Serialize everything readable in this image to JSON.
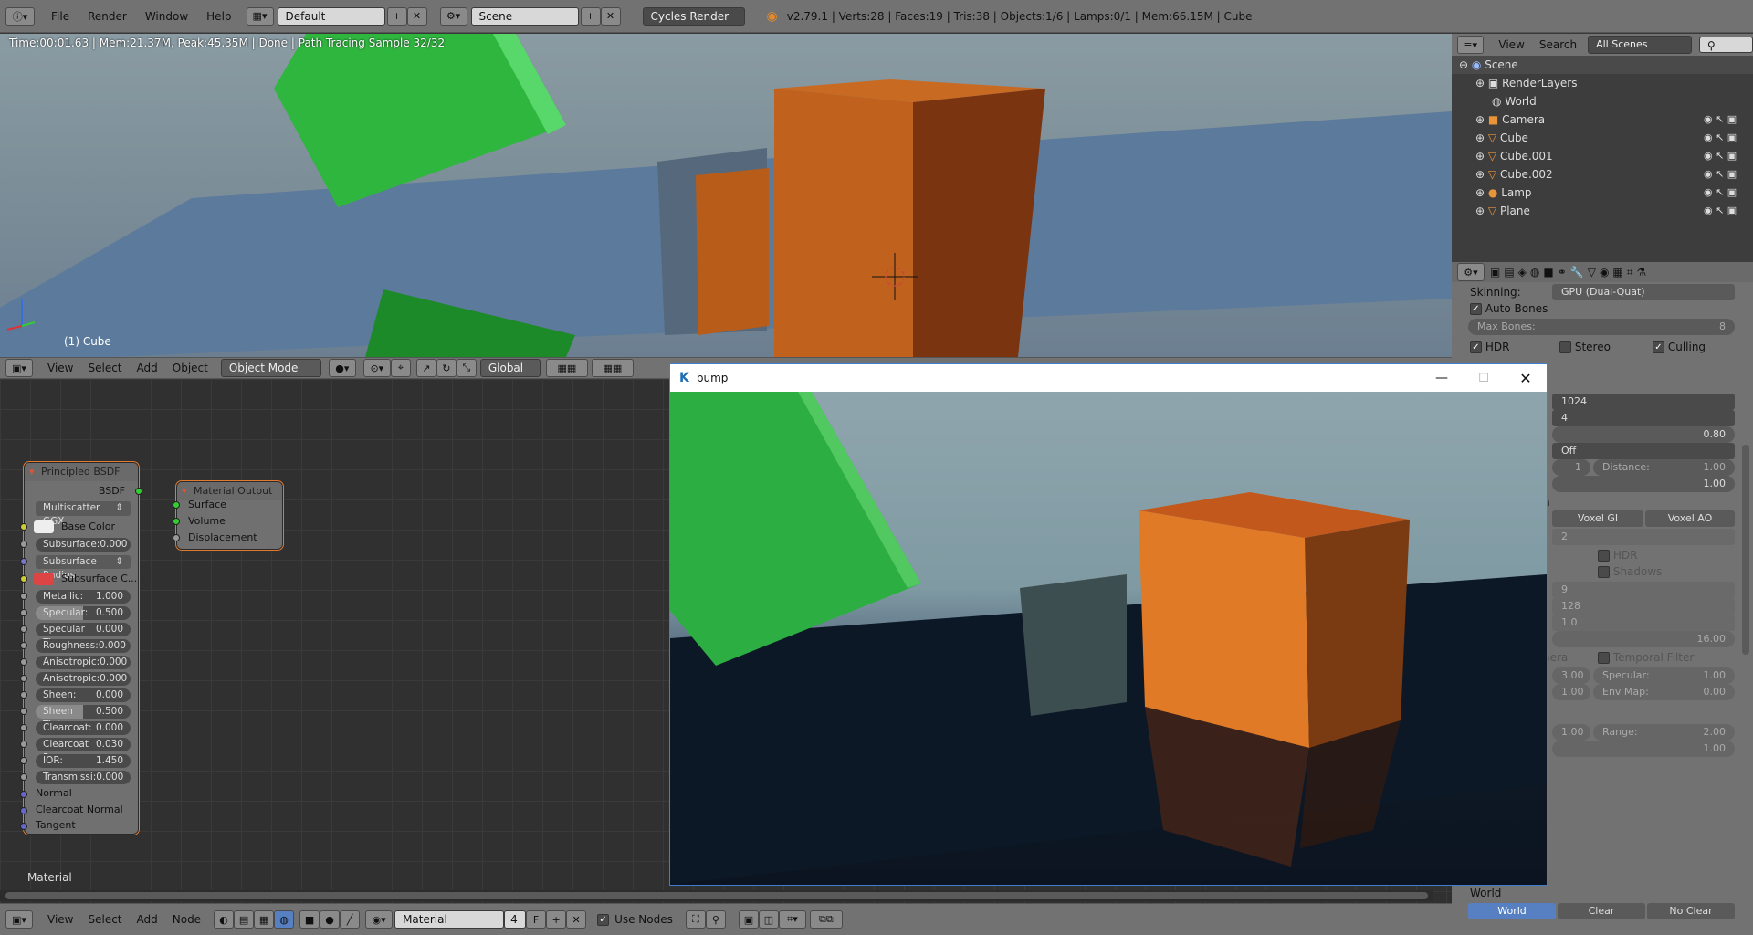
{
  "topbar": {
    "menus": [
      "File",
      "Render",
      "Window",
      "Help"
    ],
    "layout": "Default",
    "scene": "Scene",
    "engine": "Cycles Render",
    "stats": "v2.79.1 | Verts:28 | Faces:19 | Tris:38 | Objects:1/6 | Lamps:0/1 | Mem:66.15M | Cube"
  },
  "viewport": {
    "render_status": "Time:00:01.63 | Mem:21.37M, Peak:45.35M | Done | Path Tracing Sample 32/32",
    "object_label": "(1) Cube",
    "header": {
      "menus": [
        "View",
        "Select",
        "Add",
        "Object"
      ],
      "mode": "Object Mode",
      "orientation": "Global"
    }
  },
  "outliner": {
    "menus": [
      "View",
      "Search"
    ],
    "filter": "All Scenes",
    "items": [
      "Scene",
      "RenderLayers",
      "World",
      "Camera",
      "Cube",
      "Cube.001",
      "Cube.002",
      "Lamp",
      "Plane"
    ]
  },
  "properties": {
    "skinning_label": "Skinning:",
    "skinning_value": "GPU (Dual-Quat)",
    "auto_bones": "Auto Bones",
    "max_bones_label": "Max Bones:",
    "max_bones_value": "8",
    "hdr": "HDR",
    "stereo": "Stereo",
    "culling": "Culling",
    "v1024": "1024",
    "v4": "4",
    "v080": "0.80",
    "off": "Off",
    "v1": "1",
    "distance_label": "Distance:",
    "distance_value": "1.00",
    "v100a": "1.00",
    "h_letter": "h",
    "voxel_gi": "Voxel GI",
    "voxel_ao": "Voxel AO",
    "v2": "2",
    "hdr2": "HDR",
    "shadows": "Shadows",
    "v9": "9",
    "v128": "128",
    "v10": "1.0",
    "v1600": "16.00",
    "nera": "nera",
    "temporal_filter": "Temporal Filter",
    "v300": "3.00",
    "specular_label": "Specular:",
    "specular_value": "1.00",
    "v100b": "1.00",
    "envmap_label": "Env Map:",
    "envmap_value": "0.00",
    "v100c": "1.00",
    "range_label": "Range:",
    "range_value": "2.00",
    "v100d": "1.00",
    "world_section": "World",
    "world_btn": "World",
    "clear_btn": "Clear",
    "noclear_btn": "No Clear"
  },
  "bump_window": {
    "title": "bump"
  },
  "node_editor": {
    "principled": {
      "title": "Principled BSDF",
      "output": "BSDF",
      "distribution": "Multiscatter GGX",
      "base_color": "Base Color",
      "subsurface": "Subsurface:",
      "subsurface_v": "0.000",
      "subsurface_radius": "Subsurface Radius",
      "subsurface_color": "Subsurface C...",
      "metallic": "Metallic:",
      "metallic_v": "1.000",
      "specular": "Specular:",
      "specular_v": "0.500",
      "spec_tint": "Specular Ti:",
      "spec_tint_v": "0.000",
      "roughness": "Roughness:",
      "roughness_v": "0.000",
      "aniso": "Anisotropic:",
      "aniso_v": "0.000",
      "aniso_rot": "Anisotropic:",
      "aniso_rot_v": "0.000",
      "sheen": "Sheen:",
      "sheen_v": "0.000",
      "sheen_tint": "Sheen Tint:",
      "sheen_tint_v": "0.500",
      "clearcoat": "Clearcoat:",
      "clearcoat_v": "0.000",
      "clearcoat_r": "Clearcoat R:",
      "clearcoat_r_v": "0.030",
      "ior": "IOR:",
      "ior_v": "1.450",
      "transmission": "Transmissi:",
      "transmission_v": "0.000",
      "normal": "Normal",
      "clearcoat_normal": "Clearcoat Normal",
      "tangent": "Tangent"
    },
    "output_node": {
      "title": "Material Output",
      "surface": "Surface",
      "volume": "Volume",
      "displacement": "Displacement"
    },
    "footer_label": "Material",
    "header": {
      "menus": [
        "View",
        "Select",
        "Add",
        "Node"
      ],
      "material": "Material",
      "users": "4",
      "fake": "F",
      "use_nodes": "Use Nodes"
    }
  }
}
